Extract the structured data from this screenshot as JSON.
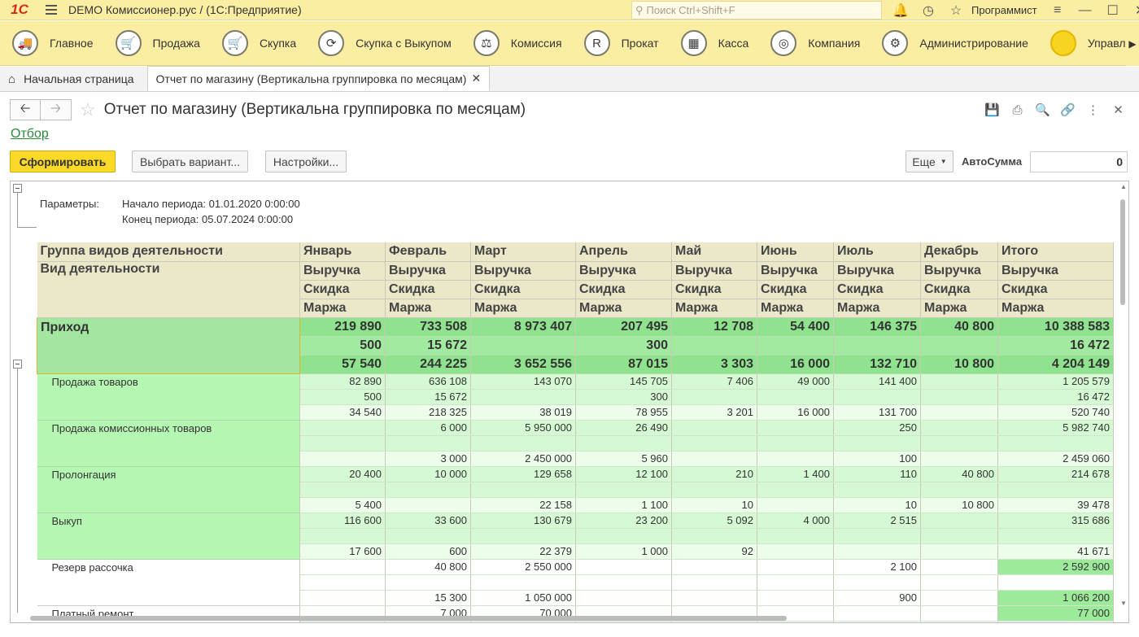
{
  "app": {
    "logo": "1С",
    "title": "DEMO Комиссионер.рус /   (1С:Предприятие)",
    "search_placeholder": "Поиск Ctrl+Shift+F",
    "user": "Программист"
  },
  "sections": [
    {
      "label": "Главное",
      "icon": "truck-icon",
      "glyph": "🚚"
    },
    {
      "label": "Продажа",
      "icon": "cart-icon",
      "glyph": "🛒"
    },
    {
      "label": "Скупка",
      "icon": "basket-icon",
      "glyph": "🛒"
    },
    {
      "label": "Скупка с Выкупом",
      "icon": "cycle-icon",
      "glyph": "⟳"
    },
    {
      "label": "Комиссия",
      "icon": "scales-icon",
      "glyph": "⚖"
    },
    {
      "label": "Прокат",
      "icon": "rent-icon",
      "glyph": "R"
    },
    {
      "label": "Касса",
      "icon": "cash-register-icon",
      "glyph": "▦"
    },
    {
      "label": "Компания",
      "icon": "company-icon",
      "glyph": "◎"
    },
    {
      "label": "Администрирование",
      "icon": "gears-icon",
      "glyph": "⚙"
    },
    {
      "label": "Управлени",
      "icon": "sun-icon",
      "glyph": "●"
    }
  ],
  "tabs": {
    "home": "Начальная страница",
    "report": "Отчет по магазину (Вертикальна группировка по месяцам)"
  },
  "form": {
    "title": "Отчет по магазину (Вертикальна группировка по месяцам)",
    "filter_link": "Отбор",
    "generate": "Сформировать",
    "choose_variant": "Выбрать вариант...",
    "settings": "Настройки...",
    "more": "Еще",
    "autosum_label": "АвтоСумма",
    "autosum_value": "0"
  },
  "params": {
    "label": "Параметры:",
    "start": "Начало периода: 01.01.2020 0:00:00",
    "end": "Конец периода: 05.07.2024 0:00:00"
  },
  "report": {
    "header": {
      "group_label": "Группа видов деятельности",
      "kind_label": "Вид деятельности",
      "months": [
        "Январь",
        "Февраль",
        "Март",
        "Апрель",
        "Май",
        "Июнь",
        "Июль",
        "Декабрь",
        "Итого"
      ],
      "metric_1": "Выручка",
      "metric_2": "Скидка",
      "metric_3": "Маржа"
    },
    "total": {
      "label": "Приход",
      "revenue": [
        "219 890",
        "733 508",
        "8 973 407",
        "207 495",
        "12 708",
        "54 400",
        "146 375",
        "40 800",
        "10 388 583"
      ],
      "discount": [
        "500",
        "15 672",
        "",
        "300",
        "",
        "",
        "",
        "",
        "16 472"
      ],
      "margin": [
        "57 540",
        "244 225",
        "3 652 556",
        "87 015",
        "3 303",
        "16 000",
        "132 710",
        "10 800",
        "4 204 149"
      ]
    },
    "rows": [
      {
        "label": "Продажа товаров",
        "revenue": [
          "82 890",
          "636 108",
          "143 070",
          "145 705",
          "7 406",
          "49 000",
          "141 400",
          "",
          "1 205 579"
        ],
        "discount": [
          "500",
          "15 672",
          "",
          "300",
          "",
          "",
          "",
          "",
          "16 472"
        ],
        "margin": [
          "34 540",
          "218 325",
          "38 019",
          "78 955",
          "3 201",
          "16 000",
          "131 700",
          "",
          "520 740"
        ]
      },
      {
        "label": "Продажа комиссионных товаров",
        "revenue": [
          "",
          "6 000",
          "5 950 000",
          "26 490",
          "",
          "",
          "250",
          "",
          "5 982 740"
        ],
        "discount": [
          "",
          "",
          "",
          "",
          "",
          "",
          "",
          "",
          ""
        ],
        "margin": [
          "",
          "3 000",
          "2 450 000",
          "5 960",
          "",
          "",
          "100",
          "",
          "2 459 060"
        ]
      },
      {
        "label": "Пролонгация",
        "revenue": [
          "20 400",
          "10 000",
          "129 658",
          "12 100",
          "210",
          "1 400",
          "110",
          "40 800",
          "214 678"
        ],
        "discount": [
          "",
          "",
          "",
          "",
          "",
          "",
          "",
          "",
          ""
        ],
        "margin": [
          "5 400",
          "",
          "22 158",
          "1 100",
          "10",
          "",
          "10",
          "10 800",
          "39 478"
        ]
      },
      {
        "label": "Выкуп",
        "revenue": [
          "116 600",
          "33 600",
          "130 679",
          "23 200",
          "5 092",
          "4 000",
          "2 515",
          "",
          "315 686"
        ],
        "discount": [
          "",
          "",
          "",
          "",
          "",
          "",
          "",
          "",
          ""
        ],
        "margin": [
          "17 600",
          "600",
          "22 379",
          "1 000",
          "92",
          "",
          "",
          "",
          "41 671"
        ]
      },
      {
        "label": "Резерв рассочка",
        "white": true,
        "revenue": [
          "",
          "40 800",
          "2 550 000",
          "",
          "",
          "",
          "2 100",
          "",
          "2 592 900"
        ],
        "discount": [
          "",
          "",
          "",
          "",
          "",
          "",
          "",
          "",
          ""
        ],
        "margin": [
          "",
          "15 300",
          "1 050 000",
          "",
          "",
          "",
          "900",
          "",
          "1 066 200"
        ]
      },
      {
        "label": "Платный ремонт",
        "white": true,
        "revenue": [
          "",
          "7 000",
          "70 000",
          "",
          "",
          "",
          "",
          "",
          "77 000"
        ],
        "discount": [
          "",
          "",
          "",
          "",
          "",
          "",
          "",
          "",
          ""
        ],
        "margin": [
          "",
          "",
          "",
          "",
          "",
          "",
          "",
          "",
          ""
        ]
      }
    ]
  }
}
